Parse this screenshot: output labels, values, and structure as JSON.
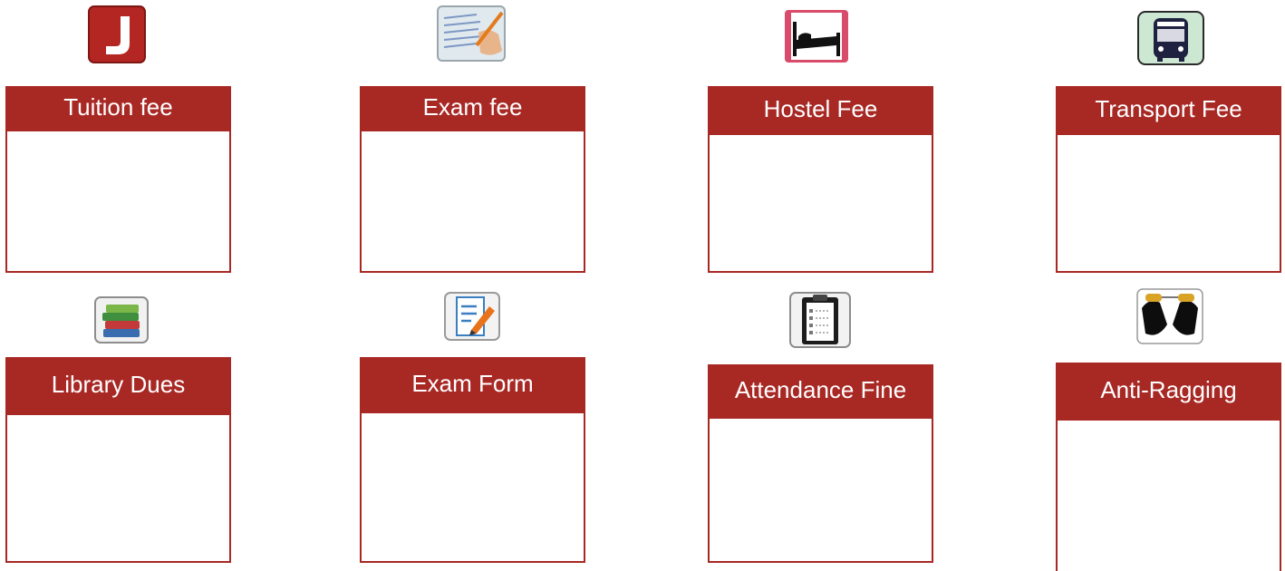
{
  "colors": {
    "accent": "#a82824",
    "background": "#ffffff"
  },
  "tiles": [
    {
      "label": "Tuition fee",
      "icon": "letter-j-icon"
    },
    {
      "label": "Exam fee",
      "icon": "exam-sheet-icon"
    },
    {
      "label": "Hostel Fee",
      "icon": "bed-icon"
    },
    {
      "label": "Transport Fee",
      "icon": "bus-icon"
    },
    {
      "label": "Library Dues",
      "icon": "books-icon"
    },
    {
      "label": "Exam Form",
      "icon": "form-edit-icon"
    },
    {
      "label": "Attendance Fine",
      "icon": "clipboard-icon"
    },
    {
      "label": "Anti-Ragging",
      "icon": "handcuffs-icon"
    }
  ]
}
